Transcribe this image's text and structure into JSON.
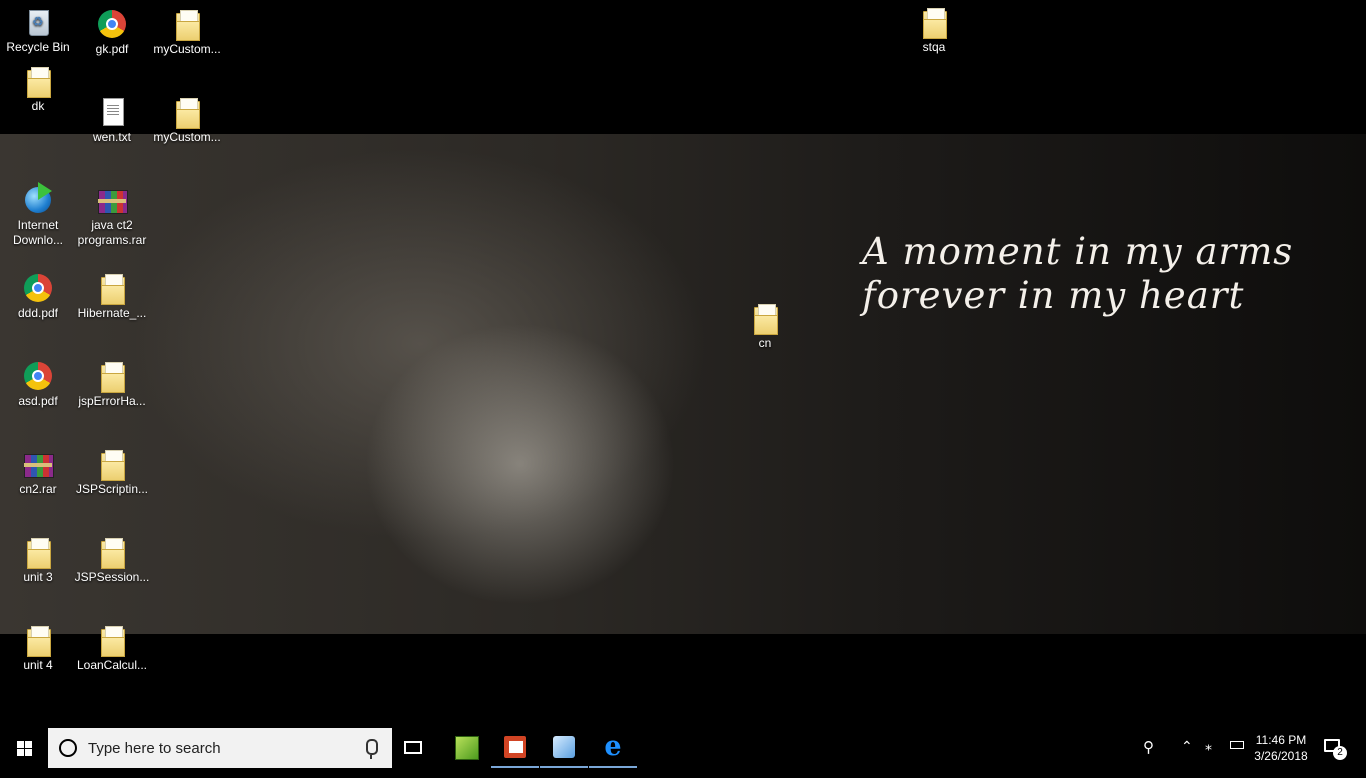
{
  "wallpaper": {
    "quote_line1": "A moment in my arms",
    "quote_line2": "forever in my heart"
  },
  "desktop_icons": [
    {
      "label": "Recycle Bin",
      "icon": "recycle-bin-icon"
    },
    {
      "label": "gk.pdf",
      "icon": "chrome-pdf-icon"
    },
    {
      "label": "myCustom...",
      "icon": "folder-icon"
    },
    {
      "label": "stqa",
      "icon": "folder-icon"
    },
    {
      "label": "dk",
      "icon": "folder-icon"
    },
    {
      "label": "wen.txt",
      "icon": "text-file-icon"
    },
    {
      "label": "myCustom...",
      "icon": "folder-icon"
    },
    {
      "label": "Internet Downlo...",
      "icon": "internet-download-manager-icon"
    },
    {
      "label": "java ct2 programs.rar",
      "icon": "winrar-archive-icon"
    },
    {
      "label": "ddd.pdf",
      "icon": "chrome-pdf-icon"
    },
    {
      "label": "Hibernate_...",
      "icon": "folder-icon"
    },
    {
      "label": "cn",
      "icon": "folder-icon"
    },
    {
      "label": "asd.pdf",
      "icon": "chrome-pdf-icon"
    },
    {
      "label": "jspErrorHa...",
      "icon": "folder-icon"
    },
    {
      "label": "cn2.rar",
      "icon": "winrar-archive-icon"
    },
    {
      "label": "JSPScriptin...",
      "icon": "folder-icon"
    },
    {
      "label": "unit 3",
      "icon": "folder-icon"
    },
    {
      "label": "JSPSession...",
      "icon": "folder-icon"
    },
    {
      "label": "unit 4",
      "icon": "folder-icon"
    },
    {
      "label": "LoanCalcul...",
      "icon": "folder-icon"
    }
  ],
  "taskbar": {
    "search_placeholder": "Type here to search",
    "pinned_apps": [
      {
        "icon": "notepad-plus-plus-icon"
      },
      {
        "icon": "powerpoint-icon"
      },
      {
        "icon": "virtualbox-icon"
      },
      {
        "icon": "internet-explorer-icon"
      }
    ],
    "clock_time": "11:46 PM",
    "clock_date": "3/26/2018",
    "notification_count": "2"
  },
  "colors": {
    "desktop_background": "#000000",
    "search_box": "#f2f2f2",
    "active_app_underline": "#7aa7d8"
  }
}
